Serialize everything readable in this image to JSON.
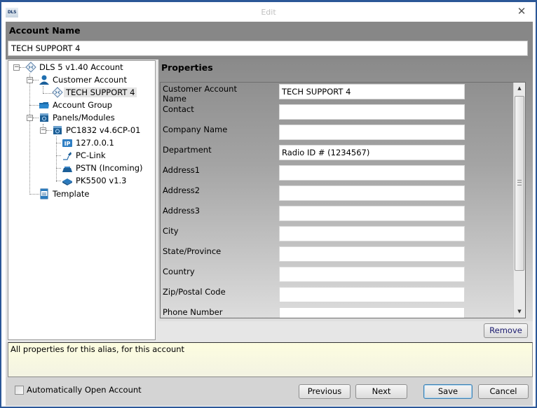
{
  "window": {
    "title": "Edit",
    "logo_text": "DLS",
    "close_glyph": "✕"
  },
  "account": {
    "label": "Account Name",
    "value": "TECH SUPPORT 4"
  },
  "tree": {
    "nodes": [
      {
        "label": "DLS 5 v1.40 Account",
        "icon": "account-diamond-icon",
        "expanded": true,
        "selected": false
      },
      {
        "label": "Customer Account",
        "icon": "customer-person-icon",
        "expanded": true,
        "selected": false
      },
      {
        "label": "TECH SUPPORT 4",
        "icon": "account-diamond-icon",
        "selected": true
      },
      {
        "label": "Account Group",
        "icon": "folder-icon",
        "selected": false
      },
      {
        "label": "Panels/Modules",
        "icon": "panel-module-icon",
        "expanded": true,
        "selected": false
      },
      {
        "label": "PC1832 v4.6CP-01",
        "icon": "panel-module-icon",
        "expanded": true,
        "selected": false
      },
      {
        "label": "127.0.0.1",
        "icon": "ip-connection-icon",
        "selected": false
      },
      {
        "label": "PC-Link",
        "icon": "pc-link-cable-icon",
        "selected": false
      },
      {
        "label": "PSTN (Incoming)",
        "icon": "pstn-modem-icon",
        "selected": false
      },
      {
        "label": "PK5500 v1.3",
        "icon": "keypad-icon",
        "selected": false
      },
      {
        "label": "Template",
        "icon": "template-document-icon",
        "selected": false
      }
    ]
  },
  "properties": {
    "title": "Properties",
    "rows": [
      {
        "label": "Customer Account Name",
        "value": ""
      },
      {
        "label": "Contact",
        "value": ""
      },
      {
        "label": "Company Name",
        "value": ""
      },
      {
        "label": "Department",
        "value": "Radio ID # (1234567)"
      },
      {
        "label": "Address1",
        "value": ""
      },
      {
        "label": "Address2",
        "value": ""
      },
      {
        "label": "Address3",
        "value": ""
      },
      {
        "label": "City",
        "value": ""
      },
      {
        "label": "State/Province",
        "value": ""
      },
      {
        "label": "Country",
        "value": ""
      },
      {
        "label": "Zip/Postal Code",
        "value": ""
      },
      {
        "label": "Phone Number",
        "value": ""
      }
    ],
    "first_value": "TECH SUPPORT 4",
    "scroll_up_glyph": "▲",
    "scroll_down_glyph": "▼",
    "remove_label": "Remove"
  },
  "description": "All properties for this alias, for this account",
  "footer": {
    "auto_open_label": "Automatically Open Account",
    "auto_open_checked": false,
    "previous_label": "Previous",
    "next_label": "Next",
    "save_label": "Save",
    "cancel_label": "Cancel"
  },
  "colors": {
    "window_border": "#2b5797",
    "header_band": "#878787",
    "description_bg": "#fdfde0",
    "save_focus": "#3c7fb1"
  }
}
